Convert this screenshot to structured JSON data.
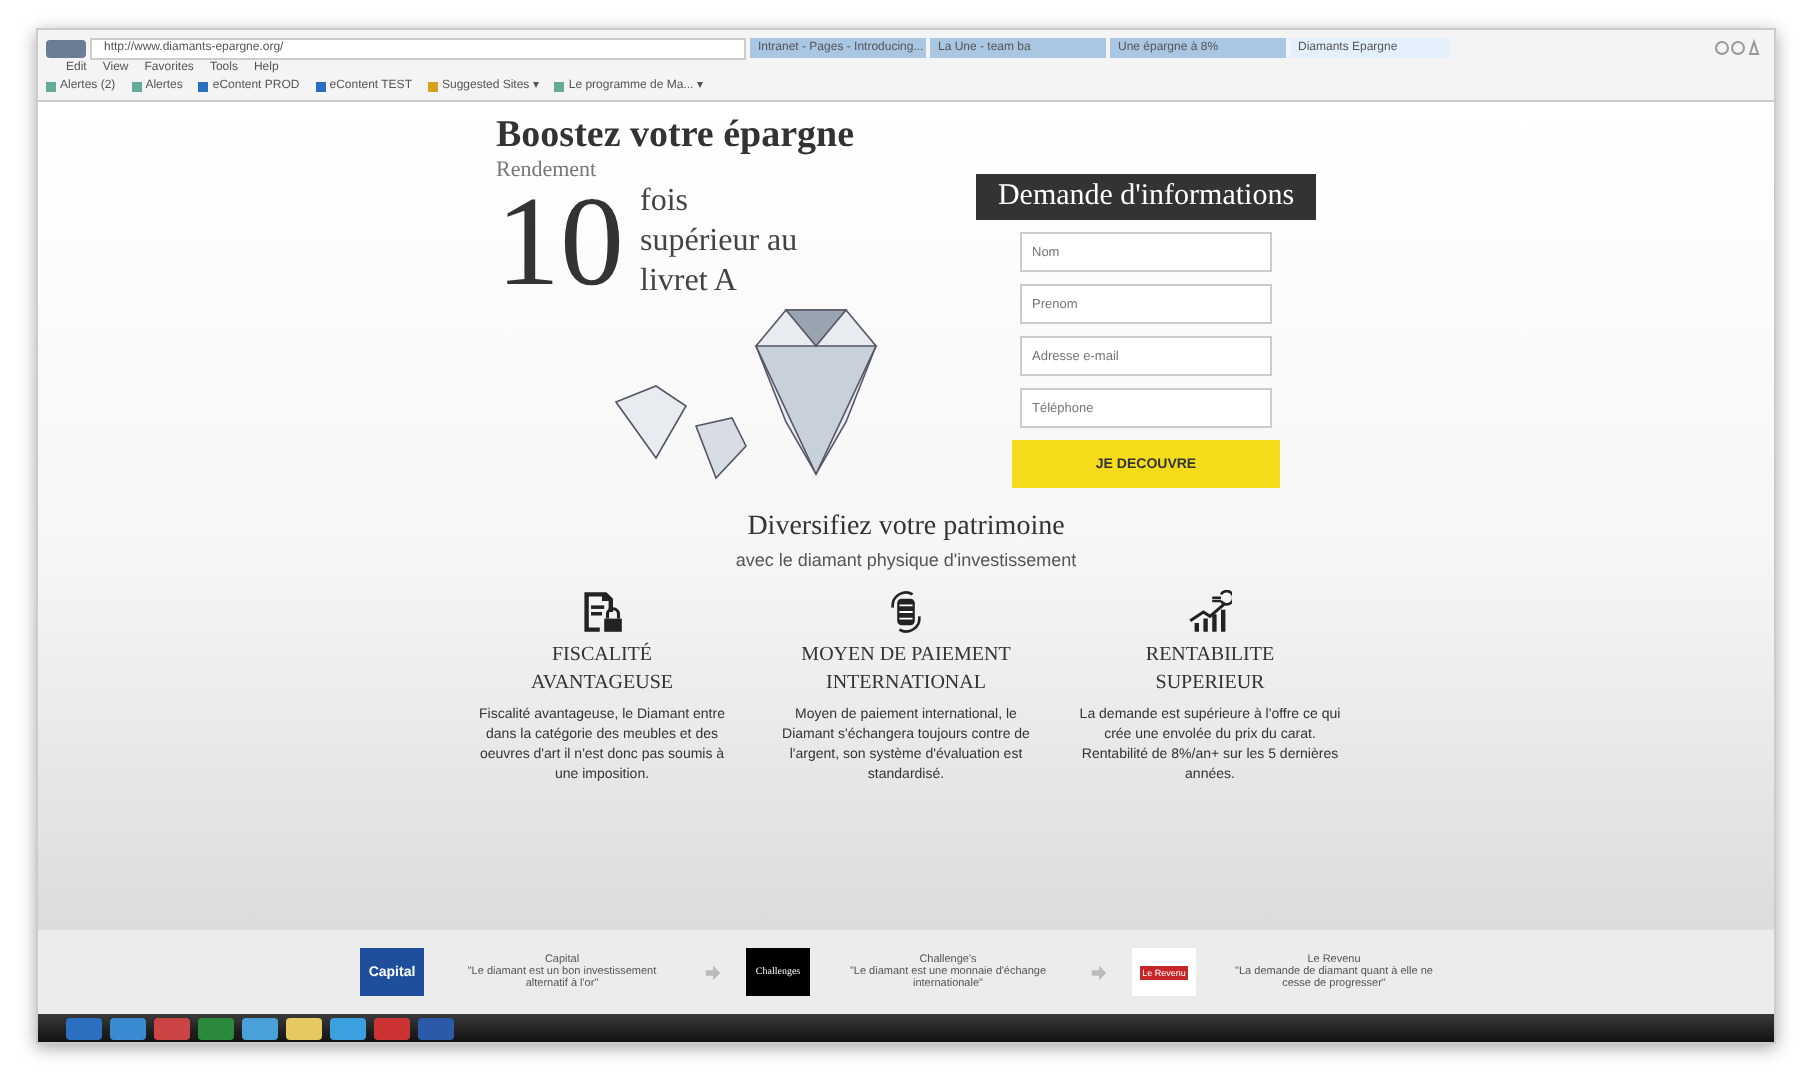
{
  "browser": {
    "address": "http://www.diamants-epargne.org/",
    "tabs": [
      {
        "label": "Intranet - Pages - Introducing...",
        "selected": false
      },
      {
        "label": "La Une - team ba",
        "selected": false
      },
      {
        "label": "Une épargne à 8%",
        "selected": false
      },
      {
        "label": "Diamants Epargne",
        "selected": true
      }
    ],
    "menu": [
      "Edit",
      "View",
      "Favorites",
      "Tools",
      "Help"
    ],
    "favorites": [
      "Alertes (2)",
      "Alertes",
      "eContent PROD",
      "eContent TEST",
      "Suggested Sites ▾",
      "Le programme de Ma... ▾"
    ]
  },
  "hero": {
    "title": "Boostez votre épargne",
    "subtitle": "Rendement",
    "big_number": "10",
    "big_text": "fois supérieur au livret A"
  },
  "form": {
    "title": "Demande d'informations",
    "fields": [
      {
        "placeholder": "Nom"
      },
      {
        "placeholder": "Prenom"
      },
      {
        "placeholder": "Adresse e-mail"
      },
      {
        "placeholder": "Téléphone"
      }
    ],
    "submit": "JE DECOUVRE"
  },
  "section": {
    "title": "Diversifiez votre patrimoine",
    "subtitle": "avec le diamant physique d'investissement"
  },
  "features": [
    {
      "kind": "tax",
      "title": "FISCALITÉ AVANTAGEUSE",
      "text": "Fiscalité avantageuse, le Diamant entre dans la catégorie des meubles et des oeuvres d'art il n'est donc pas soumis à une imposition."
    },
    {
      "kind": "payment",
      "title": "MOYEN DE PAIEMENT INTERNATIONAL",
      "text": "Moyen de paiement international, le Diamant s'échangera toujours contre de l'argent, son système d'évaluation est standardisé."
    },
    {
      "kind": "growth",
      "title": "RENTABILITE SUPERIEUR",
      "text": "La demande est supérieure à l'offre ce qui crée une envolée du prix du carat. Rentabilité de 8%/an+ sur les 5 dernières années."
    }
  ],
  "press": [
    {
      "kind": "capital",
      "logo": "Capital",
      "source": "Capital",
      "quote": "\"Le diamant est un bon investissement alternatif à l'or\""
    },
    {
      "kind": "challenges",
      "logo": "Challenges",
      "source": "Challenge's",
      "quote": "\"Le diamant est une monnaie d'échange internationale\""
    },
    {
      "kind": "revenu",
      "logo": "Le Revenu",
      "source": "Le Revenu",
      "quote": "\"La demande de diamant quant à elle ne cesse de progresser\""
    }
  ]
}
